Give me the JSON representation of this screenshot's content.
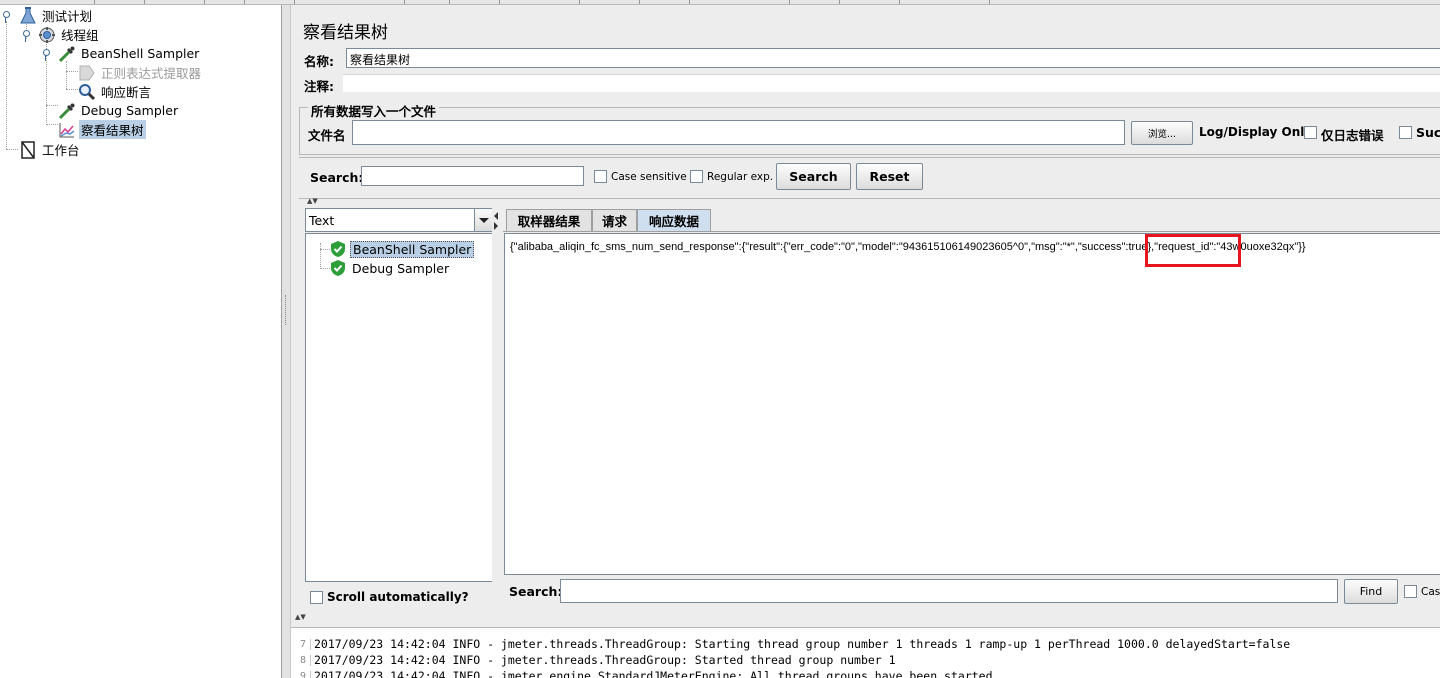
{
  "tree": {
    "items": [
      {
        "label": "测试计划",
        "icon": "test-plan-icon"
      },
      {
        "label": "线程组",
        "icon": "thread-group-icon"
      },
      {
        "label": "BeanShell Sampler",
        "icon": "sampler-pipette-icon"
      },
      {
        "label": "正则表达式提取器",
        "icon": "extractor-icon",
        "disabled": true
      },
      {
        "label": "响应断言",
        "icon": "magnifier-icon"
      },
      {
        "label": "Debug Sampler",
        "icon": "sampler-pipette-icon"
      },
      {
        "label": "察看结果树",
        "icon": "chart-icon",
        "selected": true
      },
      {
        "label": "工作台",
        "icon": "workbench-icon"
      }
    ]
  },
  "panel": {
    "title": "察看结果树",
    "name_label": "名称:",
    "name_value": "察看结果树",
    "comment_label": "注释:",
    "comment_value": "",
    "file_group_title": "所有数据写入一个文件",
    "filename_label": "文件名",
    "filename_value": "",
    "browse_label": "浏览...",
    "log_display_label": "Log/Display Only:",
    "errors_only_label": "仅日志错误",
    "successes_label": "Succ"
  },
  "search": {
    "label": "Search:",
    "value": "",
    "case_sensitive_label": "Case sensitive",
    "regex_label": "Regular exp.",
    "search_button": "Search",
    "reset_button": "Reset"
  },
  "results": {
    "renderer": "Text",
    "items": [
      {
        "label": "BeanShell Sampler",
        "status": "success",
        "selected": true
      },
      {
        "label": "Debug Sampler",
        "status": "success",
        "selected": false
      }
    ],
    "auto_scroll_label": "Scroll automatically?"
  },
  "tabs": [
    {
      "label": "取样器结果",
      "active": false
    },
    {
      "label": "请求",
      "active": false
    },
    {
      "label": "响应数据",
      "active": true
    }
  ],
  "response": {
    "text": "{\"alibaba_aliqin_fc_sms_num_send_response\":{\"result\":{\"err_code\":\"0\",\"model\":\"943615106149023605^0\",\"msg\":\"*\",\"success\":true},\"request_id\":\"43w0uoxe32qx\"}}",
    "search_label": "Search:",
    "search_value": "",
    "find_button": "Find",
    "case_label": "Case"
  },
  "log": {
    "lines": [
      {
        "num": "7",
        "text": "2017/09/23 14:42:04 INFO  - jmeter.threads.ThreadGroup: Starting thread group number 1 threads 1 ramp-up 1 perThread 1000.0 delayedStart=false"
      },
      {
        "num": "8",
        "text": "2017/09/23 14:42:04 INFO  - jmeter.threads.ThreadGroup: Started thread group number 1"
      },
      {
        "num": "9",
        "text": "2017/09/23 14:42:04 INFO  - jmeter.engine.StandardJMeterEngine: All thread groups have been started"
      }
    ]
  },
  "colors": {
    "selection": "#b8cfe5",
    "highlight_box": "#e8141e",
    "success_shield": "#2e9e3a",
    "panel_bg": "#ededed"
  }
}
